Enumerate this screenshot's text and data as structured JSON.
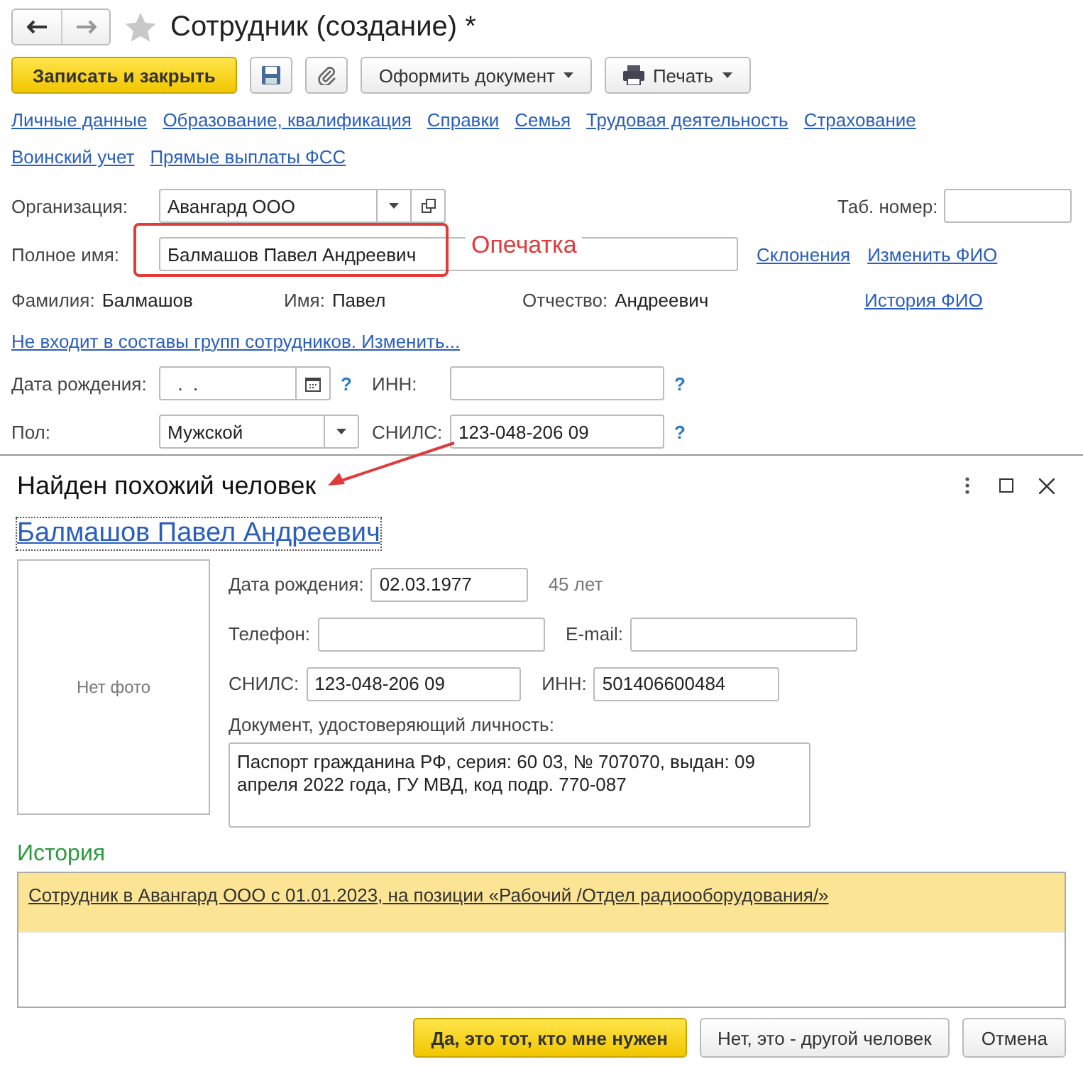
{
  "window": {
    "title": "Сотрудник (создание) *"
  },
  "toolbar": {
    "primary_button": "Записать и закрыть",
    "menu_buttons": [
      "Оформить документ",
      "Печать"
    ]
  },
  "sections": [
    "Личные данные",
    "Образование, квалификация",
    "Справки",
    "Семья",
    "Трудовая деятельность",
    "Страхование",
    "Воинский учет",
    "Прямые выплаты ФСС"
  ],
  "form": {
    "organization": {
      "label": "Организация:",
      "value": "Авангард ООО"
    },
    "tab_number": {
      "label": "Таб. номер:"
    },
    "full_name": {
      "label": "Полное имя:",
      "value": "Балмашов Павел Андреевич"
    },
    "name_links": [
      "Склонения",
      "Изменить ФИО"
    ],
    "name_parts": [
      {
        "label": "Фамилия:",
        "value": "Балмашов"
      },
      {
        "label": "Имя:",
        "value": "Павел"
      },
      {
        "label": "Отчество:",
        "value": "Андреевич"
      }
    ],
    "history_link": "История ФИО",
    "groups_link": "Не входит в составы групп сотрудников. Изменить...",
    "birth_date": {
      "label": "Дата рождения:",
      "value": ".  .",
      "help": "?"
    },
    "inn": {
      "label": "ИНН:",
      "help": "?"
    },
    "gender": {
      "label": "Пол:",
      "value": "Мужской"
    },
    "snils": {
      "label": "СНИЛС:",
      "value": "123-048-206 09",
      "help": "?"
    }
  },
  "annotation": {
    "text": "Опечатка"
  },
  "dialog": {
    "title": "Найден похожий человек",
    "person_link": "Балмашов Павел Андреевич",
    "photo": "Нет фото",
    "rows": [
      [
        {
          "label": "Дата рождения:",
          "value": "02.03.1977",
          "note": "45 лет"
        }
      ],
      [
        {
          "label": "Телефон:"
        },
        {
          "label": "E-mail:"
        }
      ],
      [
        {
          "label": "СНИЛС:",
          "value": "123-048-206 09"
        },
        {
          "label": "ИНН:",
          "value": "501406600484"
        }
      ]
    ],
    "document": {
      "label": "Документ, удостоверяющий личность:",
      "value": "Паспорт гражданина РФ, серия: 60 03, № 707070, выдан: 09 апреля 2022 года, ГУ МВД, код подр. 770-087"
    },
    "history": {
      "title": "История",
      "rows": [
        {
          "text": "Сотрудник в Авангард ООО с 01.01.2023, на позиции «Рабочий /Отдел радиооборудования/»",
          "selected": true
        }
      ]
    },
    "buttons": [
      {
        "label": "Да, это тот, кто мне нужен",
        "kind": "primary"
      },
      {
        "label": "Нет, это - другой человек",
        "kind": "default"
      },
      {
        "label": "Отмена",
        "kind": "default"
      }
    ]
  }
}
